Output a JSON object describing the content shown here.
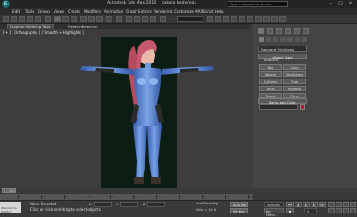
{
  "window": {
    "title": "Autodesk 3ds Max 2010",
    "file": "sakura body.max",
    "search_placeholder": "Type a keyword or phrase"
  },
  "menus": [
    "Edit",
    "Tools",
    "Group",
    "Views",
    "Create",
    "Modifiers",
    "Animation",
    "Graph Editors",
    "Rendering",
    "Customize",
    "MAXScript",
    "Help"
  ],
  "toolbar": {
    "selection_set": ""
  },
  "ribbon": {
    "tabs": [
      "Graphite Modeling Tools",
      "Freeform",
      "Selection"
    ]
  },
  "viewport": {
    "label": "[ + ] [ Orthographic ] [ Smooth + Highlights ]"
  },
  "command_panel": {
    "category": "Standard Primitives",
    "object_type_title": "Object Type",
    "autogrid": "AutoGrid",
    "buttons": [
      "Box",
      "Cone",
      "Sphere",
      "GeoSphere",
      "Cylinder",
      "Tube",
      "Torus",
      "Pyramid",
      "Teapot",
      "Plane"
    ],
    "name_color_title": "Name and Color",
    "name_value": "",
    "color": "#b01436"
  },
  "timeline": {
    "slider_label": "0 / 100",
    "ticks": [
      "0",
      "10",
      "20",
      "30",
      "40",
      "50",
      "60",
      "70",
      "80",
      "90",
      "100"
    ]
  },
  "status": {
    "listener": "Welcome to MAXScr",
    "selected": "None Selected",
    "prompt": "Click or click-and-drag to select objects",
    "x_label": "X:",
    "y_label": "Y:",
    "z_label": "Z:",
    "grid": "Grid = 10.0",
    "add_time_tag": "Add Time Tag",
    "auto_key": "Auto Key",
    "set_key": "Set Key",
    "selected_field": "Selected",
    "key_filters": "Key Filters...",
    "frame": "0"
  }
}
